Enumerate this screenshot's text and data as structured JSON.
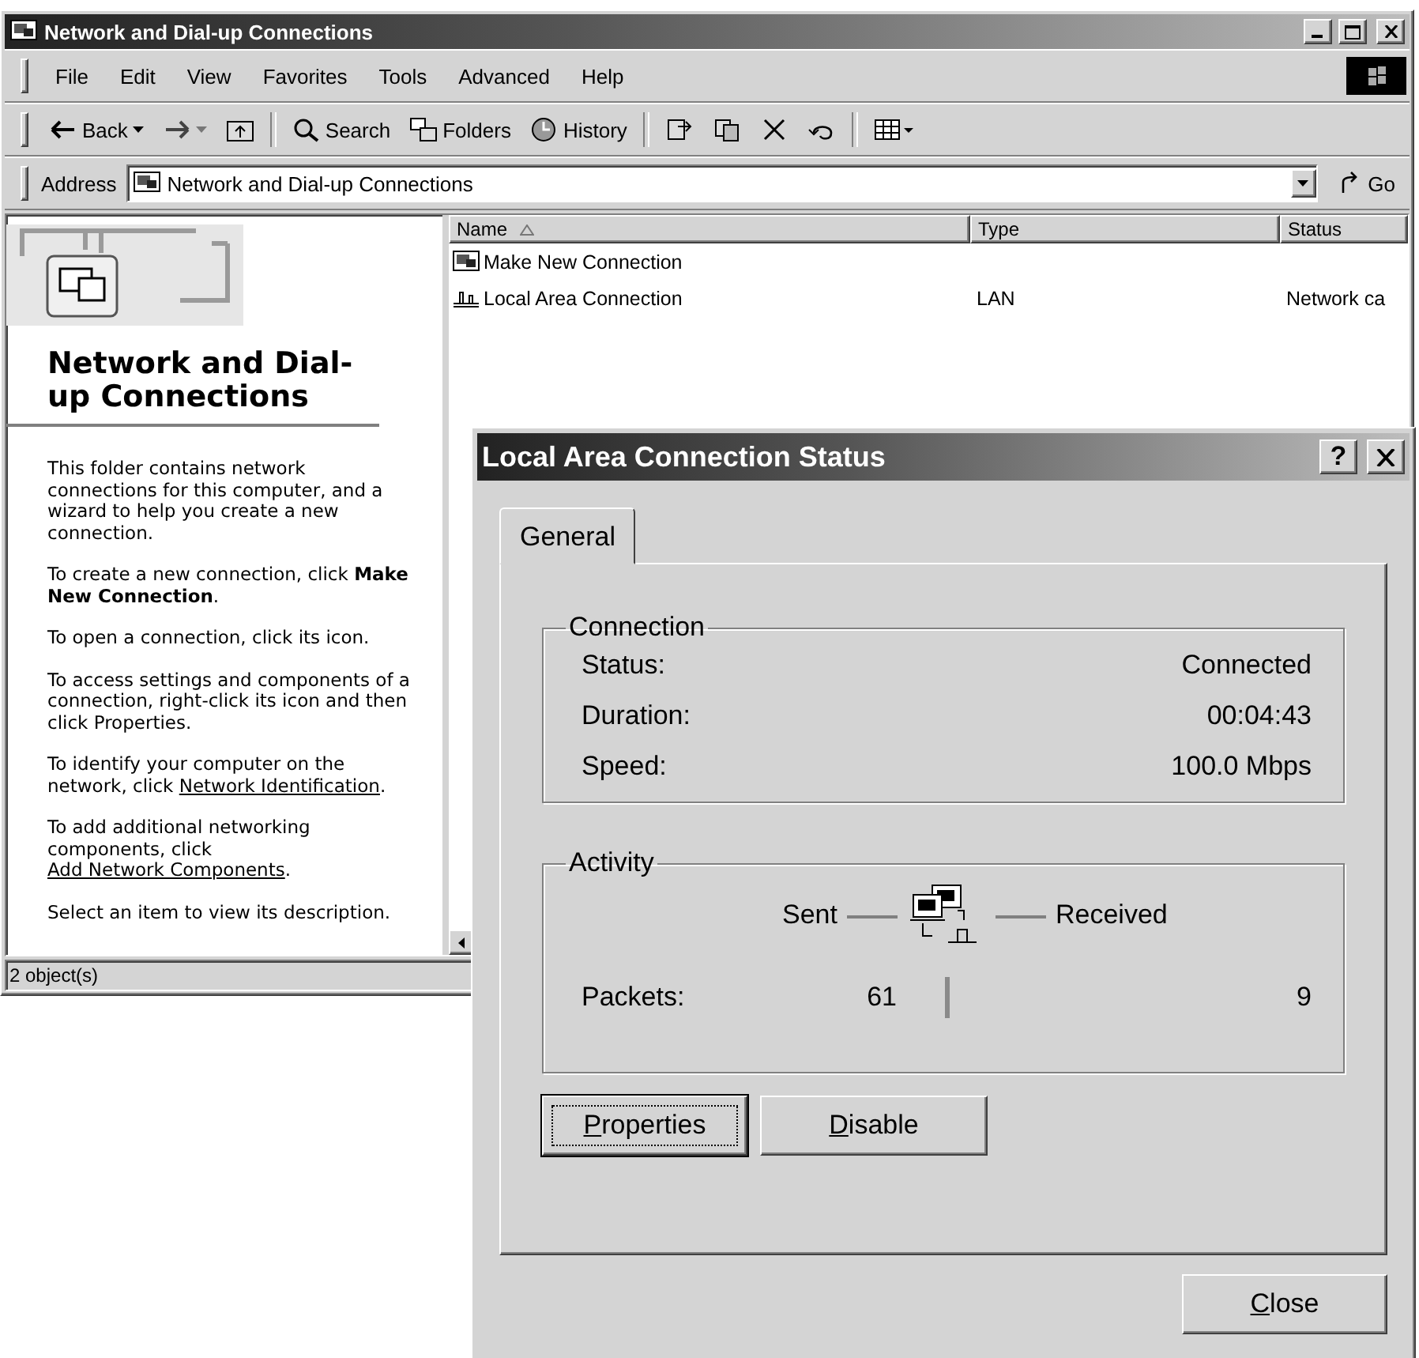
{
  "explorer": {
    "title": "Network and Dial-up Connections",
    "menu": [
      "File",
      "Edit",
      "View",
      "Favorites",
      "Tools",
      "Advanced",
      "Help"
    ],
    "toolbar": [
      {
        "kind": "back",
        "label": "Back"
      },
      {
        "kind": "forward"
      },
      {
        "kind": "up"
      },
      {
        "kind": "search",
        "label": "Search"
      },
      {
        "kind": "folders",
        "label": "Folders"
      },
      {
        "kind": "history",
        "label": "History"
      },
      {
        "kind": "move"
      },
      {
        "kind": "copy"
      },
      {
        "kind": "delete"
      },
      {
        "kind": "undo"
      },
      {
        "kind": "views"
      }
    ],
    "address": {
      "label": "Address",
      "value": "Network and Dial-up Connections",
      "go": "Go"
    },
    "panel": {
      "heading": "Network and Dial-up Connections",
      "paragraphs": [
        {
          "kind": "plain",
          "text": "This folder contains network connections for this computer, and a wizard to help you create a new connection."
        },
        {
          "kind": "plain",
          "text": "To create a new connection, click **Make New Connection**."
        },
        {
          "kind": "plain",
          "text": "To open a connection, click its icon."
        },
        {
          "kind": "plain",
          "text": "To access settings and components of a connection, right-click its icon and then click Properties."
        },
        {
          "kind": "link",
          "before": "To identify your computer on the network, click",
          "link": "Network Identification",
          "after": "."
        },
        {
          "kind": "link",
          "before": "To add additional networking components, click",
          "link": "Add Network Components",
          "after": "."
        },
        {
          "kind": "plain",
          "text": "Select an item to view its description."
        }
      ]
    },
    "columns": [
      {
        "label": "Name",
        "sorted": true
      },
      {
        "label": "Type",
        "sorted": false
      },
      {
        "label": "Status",
        "sorted": false
      }
    ],
    "rows": [
      {
        "kind": "wizard",
        "name": "Make New Connection"
      },
      {
        "kind": "lan",
        "name": "Local Area Connection",
        "type": "LAN",
        "status": "Network ca"
      }
    ],
    "status_bar": "2 object(s)"
  },
  "dialog": {
    "title": "Local Area Connection Status",
    "help": "?",
    "tabs": [
      {
        "label": "General",
        "selected": true
      }
    ],
    "connection": {
      "legend": "Connection",
      "rows": [
        {
          "label": "Status:",
          "value": "Connected"
        },
        {
          "label": "Duration:",
          "value": "00:04:43"
        },
        {
          "label": "Speed:",
          "value": "100.0 Mbps"
        }
      ]
    },
    "activity": {
      "legend": "Activity",
      "sent": "Sent",
      "received": "Received",
      "row_label": "Packets:",
      "sent_value": "61",
      "received_value": "9"
    },
    "buttons": [
      {
        "label": "Properties",
        "focused": true
      },
      {
        "label": "Disable",
        "focused": false
      }
    ],
    "close": "Close"
  }
}
